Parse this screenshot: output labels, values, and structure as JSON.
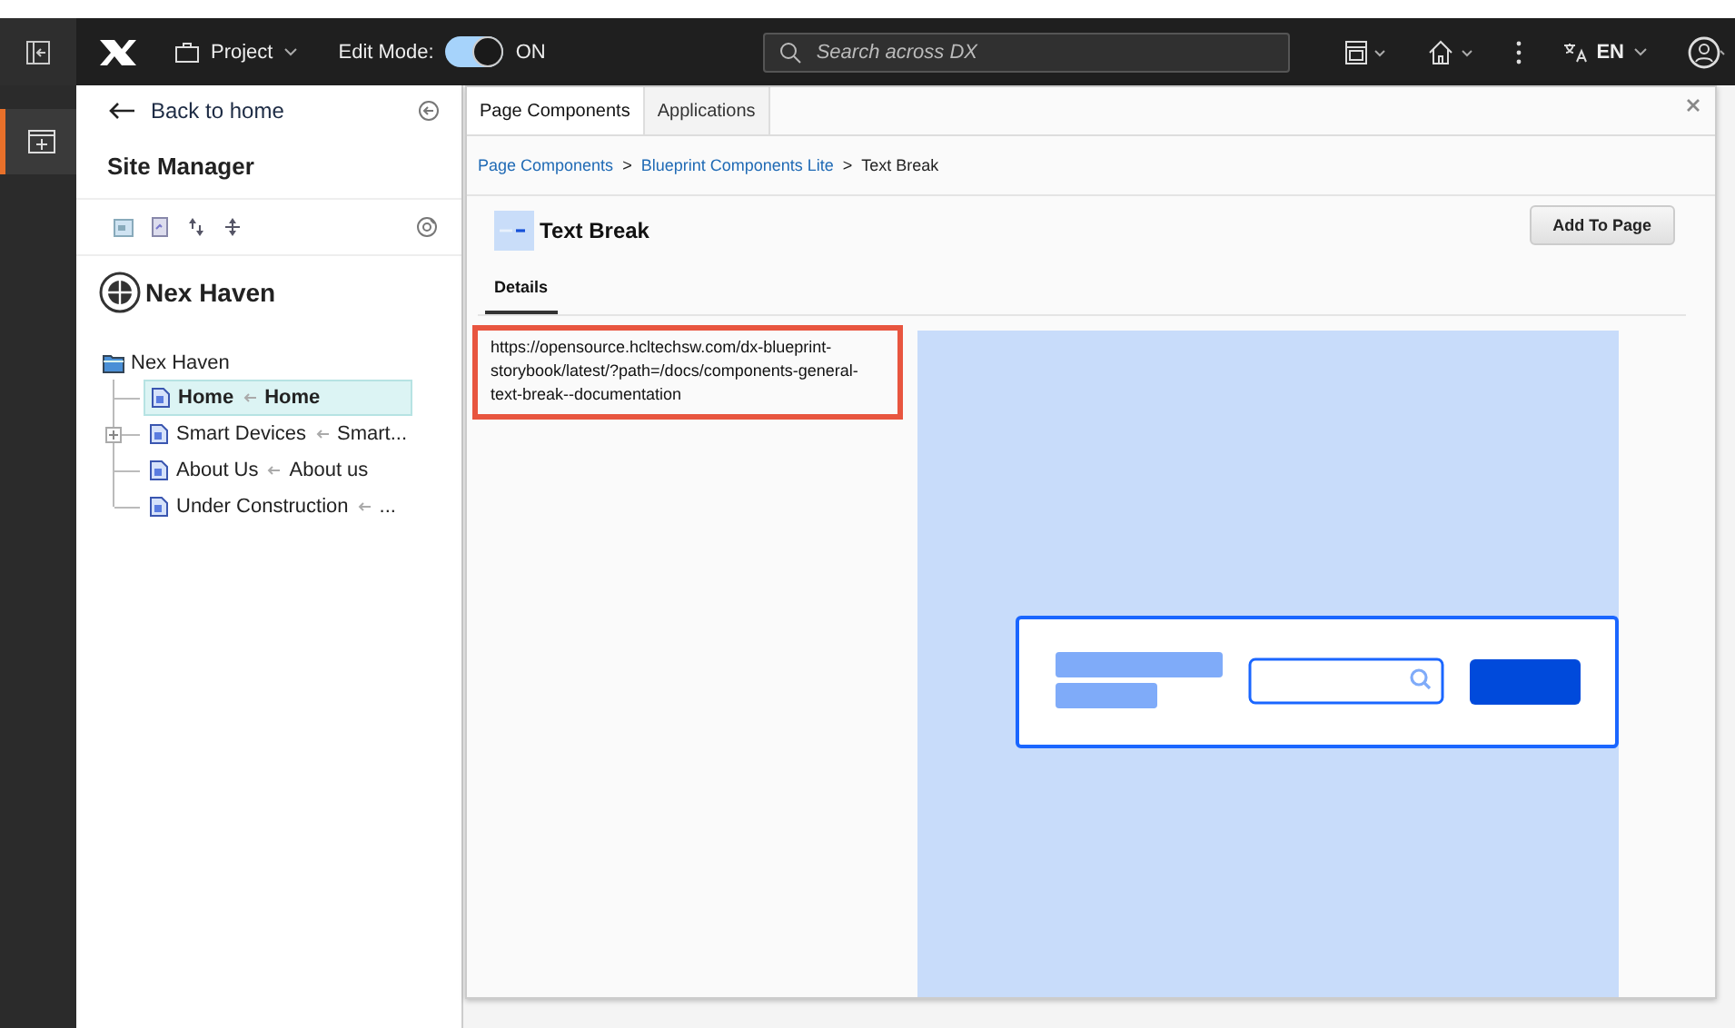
{
  "header": {
    "project_menu": "Project",
    "edit_mode_label": "Edit Mode:",
    "edit_mode": {
      "on": true,
      "label": "ON"
    },
    "search": {
      "placeholder": "Search across DX"
    },
    "language": "EN"
  },
  "rail": [
    {
      "selected": true
    }
  ],
  "sidebar": {
    "back_link": "Back to home",
    "title": "Site Manager",
    "site_name": "Nex Haven",
    "tree": [
      {
        "label": "Nex Haven",
        "expanded": true,
        "children": [
          {
            "label": "Home",
            "alias": "Home",
            "selected": true,
            "has_children": false
          },
          {
            "label": "Smart Devices",
            "alias": "Smart...",
            "selected": false,
            "has_children": true
          },
          {
            "label": "About Us",
            "alias": "About us",
            "selected": false,
            "has_children": false
          },
          {
            "label": "Under Construction",
            "alias": "...",
            "selected": false,
            "has_children": false
          }
        ]
      }
    ]
  },
  "modal": {
    "tabs": [
      {
        "label": "Page Components",
        "selected": true
      },
      {
        "label": "Applications",
        "selected": false
      }
    ],
    "breadcrumb": [
      {
        "kind": "link",
        "text": "Page Components"
      },
      {
        "kind": "separator",
        "text": ">"
      },
      {
        "kind": "link",
        "text": "Blueprint Components Lite"
      },
      {
        "kind": "separator",
        "text": ">"
      },
      {
        "kind": "current",
        "text": "Text Break"
      }
    ],
    "component_title": "Text Break",
    "add_button": "Add To Page",
    "detail_tabs": [
      {
        "label": "Details",
        "selected": true
      }
    ],
    "url": "https://opensource.hcltechsw.com/dx-blueprint-storybook/latest/?path=/docs/components-general-text-break--documentation"
  }
}
